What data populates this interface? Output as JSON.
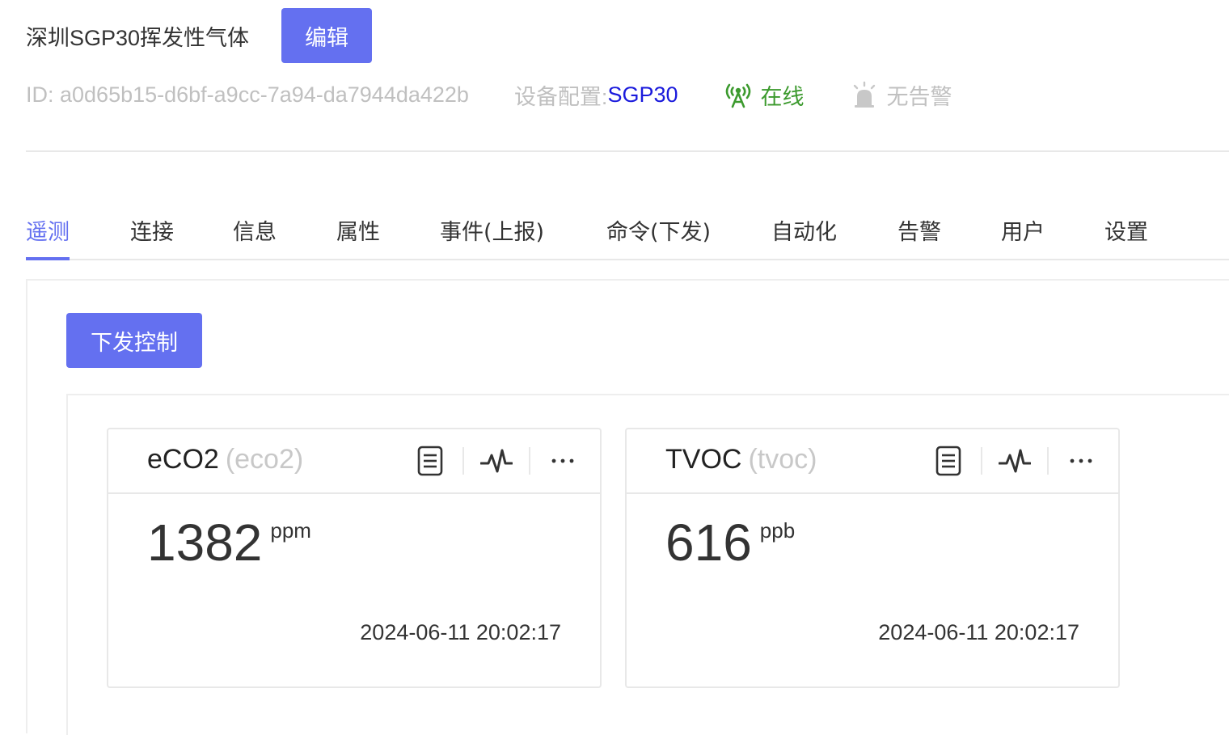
{
  "header": {
    "title": "深圳SGP30挥发性气体",
    "edit_label": "编辑",
    "id_text": "ID:  a0d65b15-d6bf-a9cc-7a94-da7944da422b",
    "profile_label": "设备配置:",
    "profile_value": "SGP30",
    "status_online": "在线",
    "status_alarm": "无告警",
    "colors": {
      "accent": "#6470f0",
      "online": "#3c9a2e",
      "link": "#1a1adc",
      "muted": "#c0c0c0"
    }
  },
  "tabs": [
    {
      "label": "遥测",
      "active": true
    },
    {
      "label": "连接"
    },
    {
      "label": "信息"
    },
    {
      "label": "属性"
    },
    {
      "label": "事件(上报)"
    },
    {
      "label": "命令(下发)"
    },
    {
      "label": "自动化"
    },
    {
      "label": "告警"
    },
    {
      "label": "用户"
    },
    {
      "label": "设置"
    }
  ],
  "telemetry": {
    "send_control_label": "下发控制",
    "cards": [
      {
        "name": "eCO2",
        "key": "(eco2)",
        "value": "1382",
        "unit": "ppm",
        "time": "2024-06-11 20:02:17",
        "icons": [
          "document-icon",
          "activity-icon",
          "more-icon"
        ]
      },
      {
        "name": "TVOC",
        "key": "(tvoc)",
        "value": "616",
        "unit": "ppb",
        "time": "2024-06-11 20:02:17",
        "icons": [
          "document-icon",
          "activity-icon",
          "more-icon"
        ]
      }
    ]
  }
}
